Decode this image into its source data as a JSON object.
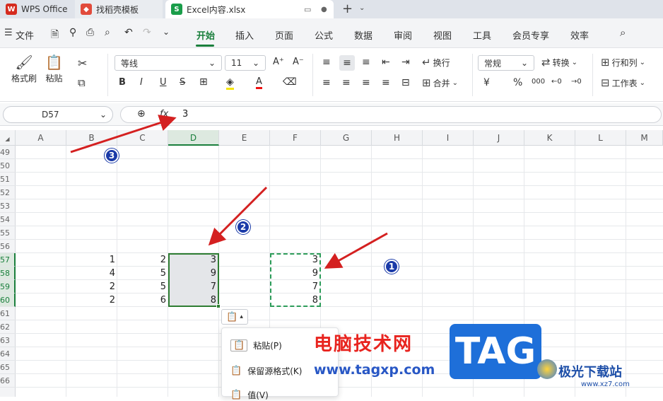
{
  "tabs": [
    {
      "label": "WPS Office"
    },
    {
      "label": "找稻壳模板"
    },
    {
      "label": "Excel内容.xlsx"
    }
  ],
  "menu": [
    "文件",
    "开始",
    "插入",
    "页面",
    "公式",
    "数据",
    "审阅",
    "视图",
    "工具",
    "会员专享",
    "效率"
  ],
  "ribbon": {
    "format_painter": "格式刷",
    "paste": "粘贴",
    "font_name": "等线",
    "font_size": "11",
    "wrap": "换行",
    "merge": "合并",
    "number_format": "常规",
    "convert": "转换",
    "row_col": "行和列",
    "worksheet": "工作表",
    "bold": "B",
    "italic": "I",
    "underline": "U",
    "strike": "S",
    "font_grow": "A⁺",
    "font_shrink": "A⁻",
    "currency": "¥",
    "percent": "%"
  },
  "formula": {
    "cell_ref": "D57",
    "fx": "fx",
    "value": "3"
  },
  "columns": [
    "A",
    "B",
    "C",
    "D",
    "E",
    "F",
    "G",
    "H",
    "I",
    "J",
    "K",
    "L",
    "M"
  ],
  "rows": [
    "49",
    "50",
    "51",
    "52",
    "53",
    "54",
    "55",
    "56",
    "57",
    "58",
    "59",
    "60",
    "61",
    "62",
    "63",
    "64",
    "65",
    "66"
  ],
  "cells": {
    "B": [
      "1",
      "4",
      "2",
      "2"
    ],
    "C": [
      "2",
      "5",
      "5",
      "6"
    ],
    "D": [
      "3",
      "9",
      "7",
      "8"
    ],
    "F": [
      "3",
      "9",
      "7",
      "8"
    ]
  },
  "paste_menu": {
    "items": [
      "粘贴(P)",
      "保留源格式(K)",
      "值(V)"
    ]
  },
  "annotations": [
    "1",
    "2",
    "3"
  ],
  "watermark": {
    "site": "电脑技术网",
    "url": "www.tagxp.com",
    "tag": "TAG",
    "brand": "极光下载站",
    "brand_url": "www.xz7.com"
  },
  "colors": {
    "accent": "#1a7f3c",
    "arrow": "#d42020",
    "badge": "#1a3aa8",
    "tag_blue": "#1e6fd9"
  }
}
